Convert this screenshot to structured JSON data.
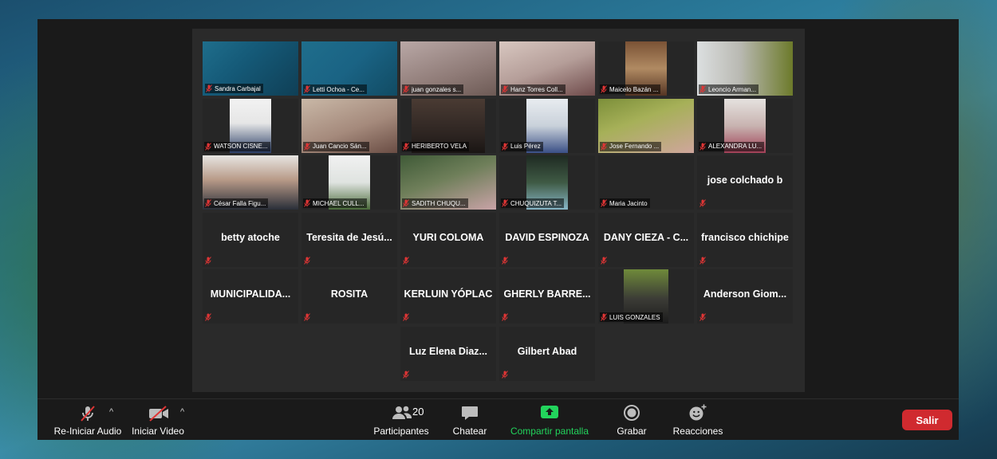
{
  "toolbar": {
    "audio_label": "Re-Iniciar Audio",
    "video_label": "Iniciar Video",
    "participants_label": "Participantes",
    "participants_count": "20",
    "chat_label": "Chatear",
    "share_label": "Compartir pantalla",
    "record_label": "Grabar",
    "reactions_label": "Reacciones",
    "leave_label": "Salir",
    "caret_glyph": "^"
  },
  "colors": {
    "active_speaker_border": "#c8ee6b",
    "share_green": "#22d35c",
    "leave_red": "#d02a2f",
    "muted_red": "#e03535"
  },
  "participants": [
    {
      "label": "Sandra Carbajal",
      "kind": "video",
      "active": true
    },
    {
      "label": "Letti Ochoa - Ce...",
      "kind": "video"
    },
    {
      "label": "juan gonzales s...",
      "kind": "video"
    },
    {
      "label": "Hanz Torres Coll...",
      "kind": "video"
    },
    {
      "label": "Maicelo Bazán ...",
      "kind": "video"
    },
    {
      "label": "Leoncio Arman...",
      "kind": "video"
    },
    {
      "label": "WATSON CISNE...",
      "kind": "video"
    },
    {
      "label": "Juan Cancio Sán...",
      "kind": "video"
    },
    {
      "label": "HERIBERTO VELA",
      "kind": "video"
    },
    {
      "label": "Luis Pérez",
      "kind": "video"
    },
    {
      "label": "Jose Fernando ...",
      "kind": "video"
    },
    {
      "label": "ALEXANDRA LU...",
      "kind": "video"
    },
    {
      "label": "César Falla Figu...",
      "kind": "video"
    },
    {
      "label": "MICHAEL CULL...",
      "kind": "video"
    },
    {
      "label": "SADITH CHUQU...",
      "kind": "video"
    },
    {
      "label": "CHUQUIZUTA T...",
      "kind": "video"
    },
    {
      "label": "Maria Jacinto",
      "kind": "blank"
    },
    {
      "label": "jose colchado b",
      "kind": "name"
    },
    {
      "label": "betty atoche",
      "kind": "name"
    },
    {
      "label": "Teresita de Jesú...",
      "kind": "name"
    },
    {
      "label": "YURI COLOMA",
      "kind": "name"
    },
    {
      "label": "DAVID ESPINOZA",
      "kind": "name"
    },
    {
      "label": "DANY CIEZA - C...",
      "kind": "name"
    },
    {
      "label": "francisco chichipe",
      "kind": "name"
    },
    {
      "label": "MUNICIPALIDA...",
      "kind": "name"
    },
    {
      "label": "ROSITA",
      "kind": "name"
    },
    {
      "label": "KERLUIN YÓPLAC",
      "kind": "name"
    },
    {
      "label": "GHERLY BARRE...",
      "kind": "name"
    },
    {
      "label": "LUIS GONZALES",
      "kind": "video"
    },
    {
      "label": "Anderson Giom...",
      "kind": "name"
    },
    {
      "label": "Luz Elena Diaz...",
      "kind": "name"
    },
    {
      "label": "Gilbert Abad",
      "kind": "name"
    }
  ]
}
